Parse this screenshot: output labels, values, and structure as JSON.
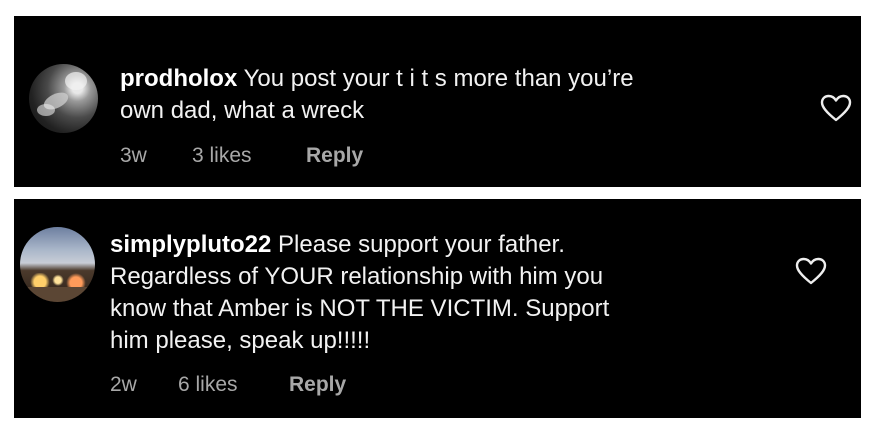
{
  "comments": [
    {
      "username": "prodholox",
      "text": "You post your t i t s more than you’re\nown dad, what a wreck",
      "age": "3w",
      "likes": "3 likes",
      "reply_label": "Reply",
      "like_icon": "heart-outline-icon"
    },
    {
      "username": "simplypluto22",
      "text": "Please support your father.\nRegardless of YOUR relationship with him you\nknow that Amber is NOT THE VICTIM. Support\nhim please, speak up!!!!!",
      "age": "2w",
      "likes": "6 likes",
      "reply_label": "Reply",
      "like_icon": "heart-outline-icon"
    }
  ],
  "colors": {
    "card_background": "#000000",
    "page_background": "#ffffff",
    "text": "#f2f2f2",
    "meta_text": "#a8a8a8"
  }
}
